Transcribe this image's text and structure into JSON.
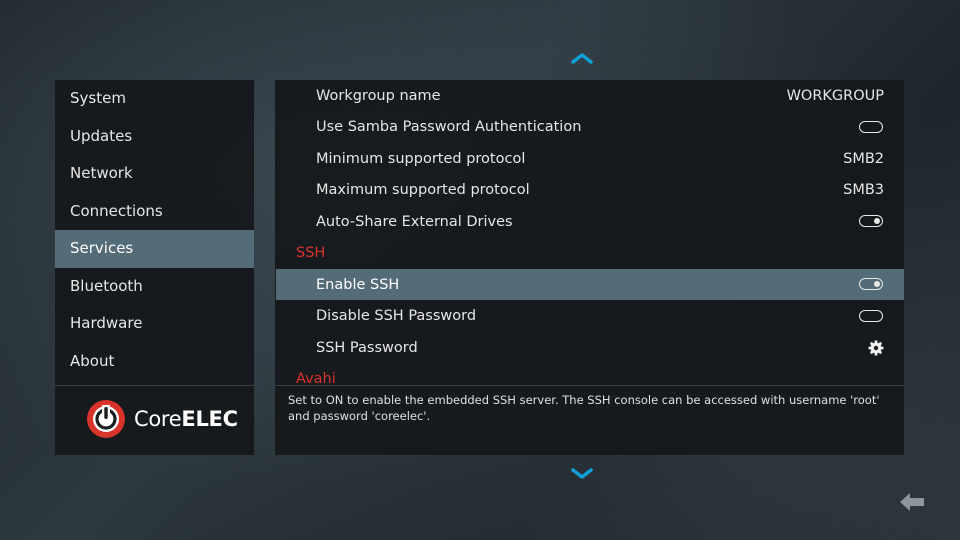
{
  "sidebar": {
    "items": [
      {
        "label": "System"
      },
      {
        "label": "Updates"
      },
      {
        "label": "Network"
      },
      {
        "label": "Connections"
      },
      {
        "label": "Services",
        "active": true
      },
      {
        "label": "Bluetooth"
      },
      {
        "label": "Hardware"
      },
      {
        "label": "About"
      }
    ],
    "logo": {
      "part1": "Core",
      "part2": "ELEC"
    }
  },
  "settings": {
    "workgroup": {
      "label": "Workgroup name",
      "value": "WORKGROUP"
    },
    "samba_password_auth": {
      "label": "Use Samba Password Authentication",
      "state": "off"
    },
    "min_protocol": {
      "label": "Minimum supported protocol",
      "value": "SMB2"
    },
    "max_protocol": {
      "label": "Maximum supported protocol",
      "value": "SMB3"
    },
    "auto_share": {
      "label": "Auto-Share External Drives",
      "state": "on"
    },
    "ssh_header": "SSH",
    "enable_ssh": {
      "label": "Enable SSH",
      "state": "on"
    },
    "disable_ssh_password": {
      "label": "Disable SSH Password",
      "state": "off"
    },
    "ssh_password": {
      "label": "SSH Password"
    },
    "avahi_header": "Avahi"
  },
  "description": "Set to ON to enable the embedded SSH server. The SSH console can be accessed with username 'root' and password 'coreelec'.",
  "colors": {
    "accent_red": "#d9342b",
    "selection": "#546b78",
    "nav_arrow": "#12a0d8"
  }
}
